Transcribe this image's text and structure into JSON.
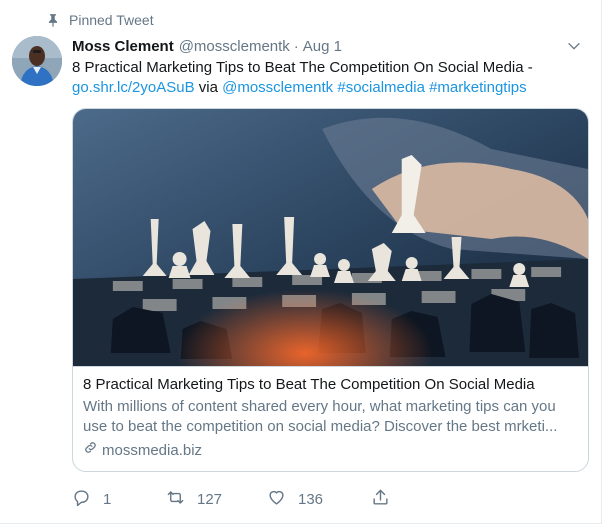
{
  "pinned": {
    "label": "Pinned Tweet"
  },
  "author": {
    "name": "Moss Clement",
    "handle": "@mossclementk",
    "separator": "·",
    "date": "Aug 1"
  },
  "tweet": {
    "text_line1": "8 Practical Marketing Tips to Beat The Competition On Social Media -",
    "link": "go.shr.lc/2yoASuB",
    "via": " via ",
    "mention": "@mossclementk",
    "hashtag1": "#socialmedia",
    "hashtag2": "#marketingtips"
  },
  "card": {
    "title": "8 Practical Marketing Tips to Beat The Competition On Social Media",
    "description": "With millions of content shared every hour, what marketing tips can you use to beat the competition on social media? Discover the best mrketi...",
    "domain": "mossmedia.biz"
  },
  "actions": {
    "replies": "1",
    "retweets": "127",
    "likes": "136"
  },
  "colors": {
    "link": "#1b95e0",
    "secondary_text": "#657786",
    "border": "#ccd6dd"
  },
  "icons": [
    "pin-icon",
    "chevron-down-icon",
    "link-icon",
    "reply-icon",
    "retweet-icon",
    "like-icon",
    "share-icon"
  ]
}
